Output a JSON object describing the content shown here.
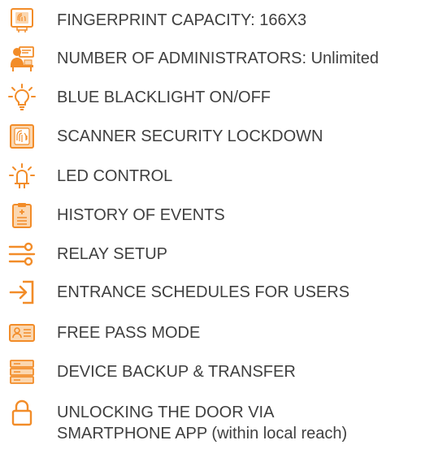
{
  "colors": {
    "accent": "#f28c28",
    "text": "#3f3f3f",
    "background": "#ffffff"
  },
  "features": [
    {
      "icon": "fingerprint-icon",
      "label": "FINGERPRINT CAPACITY: 166X3"
    },
    {
      "icon": "administrators-icon",
      "label": "NUMBER OF ADMINISTRATORS: Unlimited"
    },
    {
      "icon": "light-bulb-icon",
      "label": "BLUE BLACKLIGHT ON/OFF"
    },
    {
      "icon": "scanner-lock-icon",
      "label": "SCANNER SECURITY LOCKDOWN"
    },
    {
      "icon": "led-icon",
      "label": "LED CONTROL"
    },
    {
      "icon": "clipboard-icon",
      "label": "HISTORY OF EVENTS"
    },
    {
      "icon": "relay-icon",
      "label": "RELAY SETUP"
    },
    {
      "icon": "entrance-icon",
      "label": "ENTRANCE SCHEDULES FOR USERS"
    },
    {
      "icon": "id-card-icon",
      "label": "FREE PASS MODE"
    },
    {
      "icon": "server-icon",
      "label": "DEVICE BACKUP & TRANSFER"
    },
    {
      "icon": "padlock-icon",
      "label_line1": "UNLOCKING THE DOOR VIA",
      "label_line2": "SMARTPHONE APP (within local reach)"
    }
  ]
}
